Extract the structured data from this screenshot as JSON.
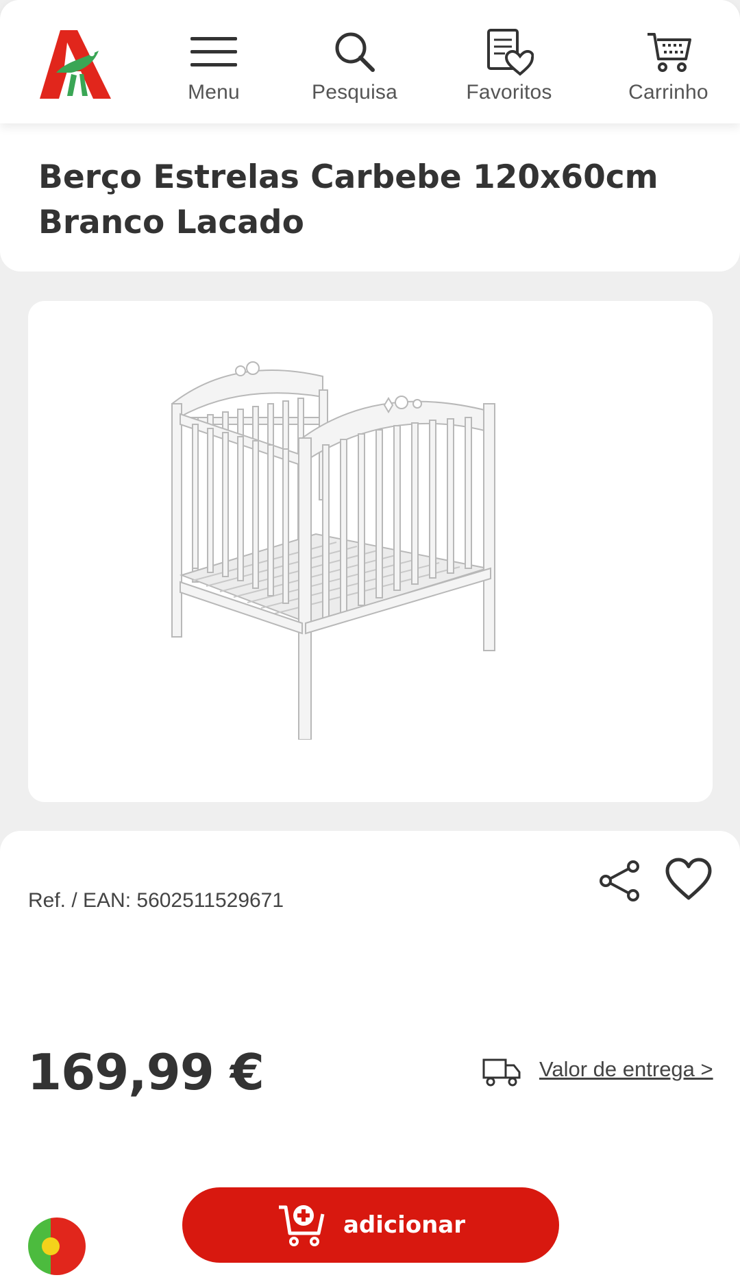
{
  "header": {
    "nav": {
      "menu_label": "Menu",
      "search_label": "Pesquisa",
      "favorites_label": "Favoritos",
      "cart_label": "Carrinho"
    },
    "icons": [
      "auchan-logo",
      "menu-icon",
      "search-icon",
      "favorites-list-icon",
      "cart-icon"
    ]
  },
  "product": {
    "title": "Berço Estrelas Carbebe 120x60cm Branco Lacado",
    "reference": "Ref. / EAN: 5602511529671",
    "price": "169,99 €",
    "delivery_link": "Valor de entrega >",
    "add_button_label": "adicionar"
  },
  "colors": {
    "brand_red": "#d8180f",
    "brand_green": "#3aa655",
    "text": "#333333",
    "background": "#efefef"
  }
}
